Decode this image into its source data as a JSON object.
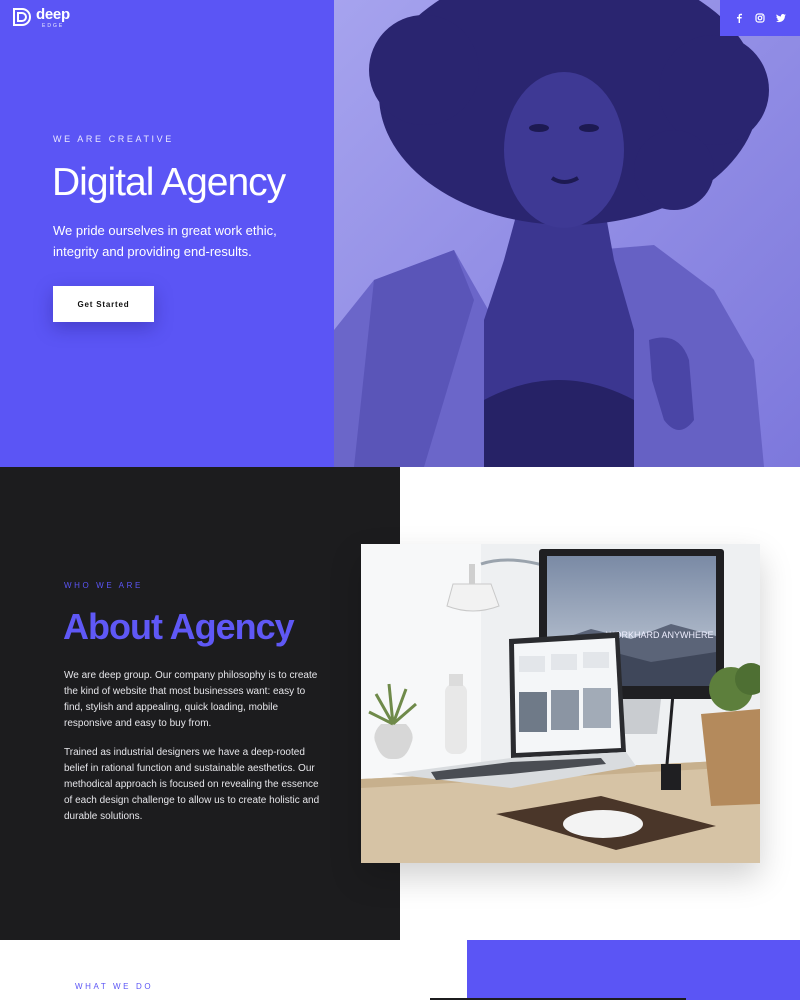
{
  "brand": {
    "name": "deep",
    "sub": "EDGE"
  },
  "colors": {
    "accent": "#5b55f5",
    "dark": "#1c1c1e"
  },
  "social": {
    "icons": [
      "facebook-icon",
      "instagram-icon",
      "twitter-icon"
    ]
  },
  "hero": {
    "kicker": "WE ARE CREATIVE",
    "title": "Digital Agency",
    "text": "We pride ourselves in great work ethic, integrity and providing end-results.",
    "button_label": "Get Started"
  },
  "about": {
    "kicker": "WHO WE ARE",
    "title": "About Agency",
    "paragraph_1": "We are deep group. Our company philosophy is to create the kind of website that most businesses want: easy to find, stylish and appealing, quick loading, mobile responsive and easy to buy from.",
    "paragraph_2": "Trained as industrial designers we have a deep-rooted belief in rational function and sustainable aesthetics. Our methodical approach is focused on revealing the essence of each design challenge to allow us to create holistic and durable solutions.",
    "monitor_text": "WORKHARD ANYWHERE"
  },
  "services": {
    "kicker": "WHAT WE DO"
  }
}
